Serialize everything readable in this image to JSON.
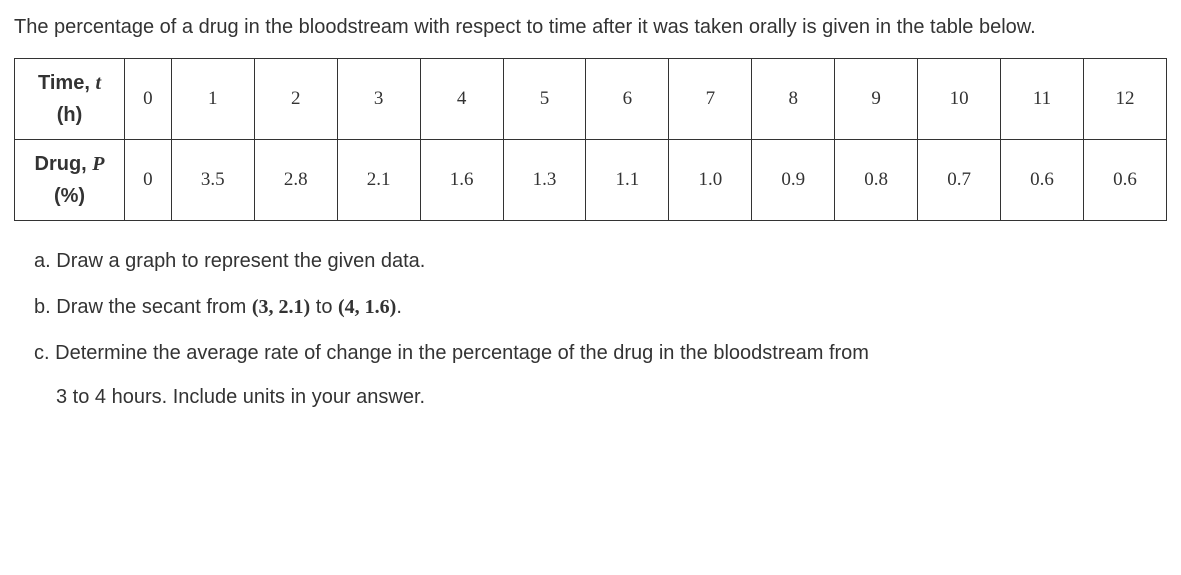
{
  "intro": "The percentage of a drug in the bloodstream with respect to time after it was taken orally is given in the table below.",
  "table": {
    "row1": {
      "label_main": "Time, ",
      "label_var": "t",
      "label_unit": "(h)",
      "values": [
        "0",
        "1",
        "2",
        "3",
        "4",
        "5",
        "6",
        "7",
        "8",
        "9",
        "10",
        "11",
        "12"
      ]
    },
    "row2": {
      "label_main": "Drug, ",
      "label_var": "P",
      "label_unit": "(%)",
      "values": [
        "0",
        "3.5",
        "2.8",
        "2.1",
        "1.6",
        "1.3",
        "1.1",
        "1.0",
        "0.9",
        "0.8",
        "0.7",
        "0.6",
        "0.6"
      ]
    }
  },
  "questions": {
    "a": {
      "label": "a.",
      "text": " Draw a graph to represent the given data."
    },
    "b": {
      "label": "b.",
      "prefix": " Draw the secant from ",
      "pair1": "(3, 2.1)",
      "mid": " to ",
      "pair2": "(4, 1.6)",
      "suffix": "."
    },
    "c": {
      "label": "c.",
      "line1": " Determine the average rate of change in the percentage of the drug in the bloodstream from",
      "line2": "3 to 4 hours. Include units in your answer."
    }
  },
  "chart_data": {
    "type": "table",
    "title": "Drug percentage in bloodstream vs time",
    "xlabel": "Time, t (h)",
    "ylabel": "Drug, P (%)",
    "x": [
      0,
      1,
      2,
      3,
      4,
      5,
      6,
      7,
      8,
      9,
      10,
      11,
      12
    ],
    "y": [
      0,
      3.5,
      2.8,
      2.1,
      1.6,
      1.3,
      1.1,
      1.0,
      0.9,
      0.8,
      0.7,
      0.6,
      0.6
    ]
  }
}
